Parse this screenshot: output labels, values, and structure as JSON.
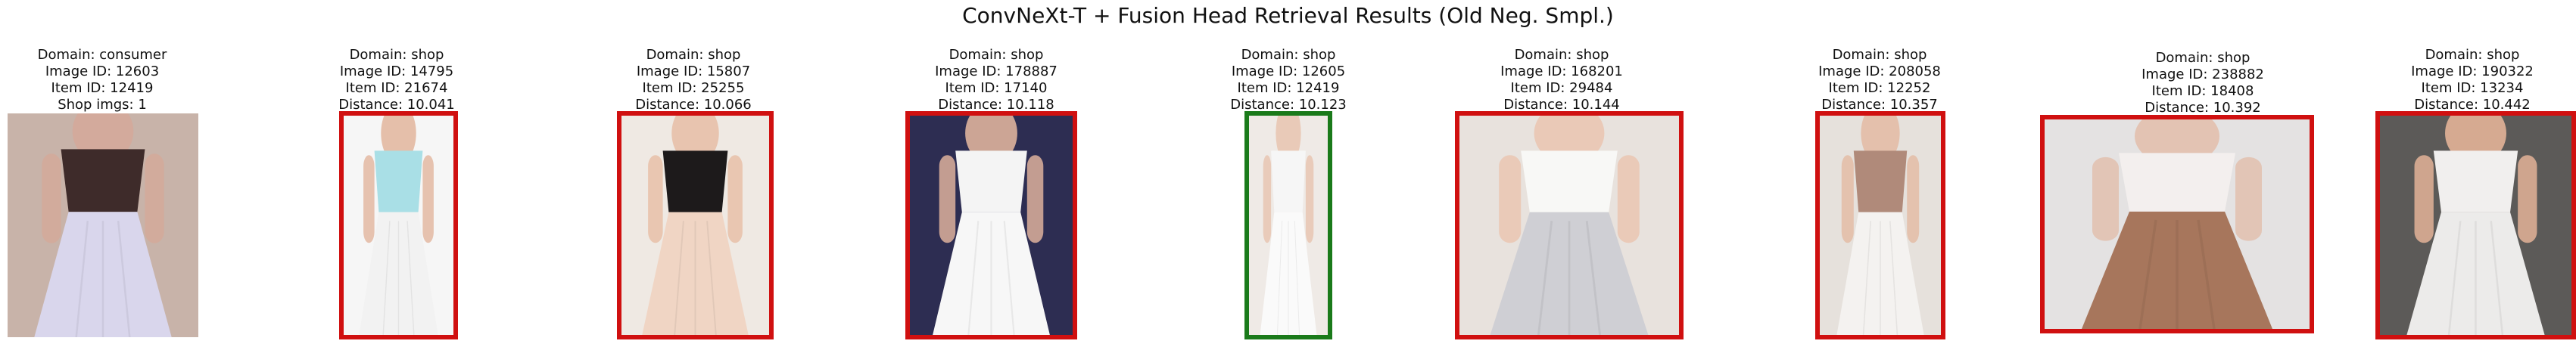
{
  "title": "ConvNeXt-T + Fusion Head Retrieval Results (Old Neg. Smpl.)",
  "results": [
    {
      "lines": [
        "Domain: consumer",
        "Image ID: 12603",
        "Item ID: 12419",
        "Shop imgs: 1"
      ],
      "match": "query",
      "border_color": "",
      "palette": {
        "bg": "#c8b3a9",
        "top": "#3e2b2a",
        "bottom": "#d9d6ec",
        "skin": "#d4a99a"
      }
    },
    {
      "lines": [
        "Domain: shop",
        "Image ID: 14795",
        "Item ID: 21674",
        "Distance: 10.041"
      ],
      "match": "incorrect",
      "border_color": "#d01010",
      "palette": {
        "bg": "#f6f6f6",
        "top": "#a9dfe6",
        "bottom": "#f2f2f2",
        "skin": "#e3b9a2"
      }
    },
    {
      "lines": [
        "Domain: shop",
        "Image ID: 15807",
        "Item ID: 25255",
        "Distance: 10.066"
      ],
      "match": "incorrect",
      "border_color": "#d01010",
      "palette": {
        "bg": "#efe9e3",
        "top": "#1d1a1b",
        "bottom": "#f0d5c4",
        "skin": "#e7c0a8"
      }
    },
    {
      "lines": [
        "Domain: shop",
        "Image ID: 178887",
        "Item ID: 17140",
        "Distance: 10.118"
      ],
      "match": "incorrect",
      "border_color": "#d01010",
      "palette": {
        "bg": "#2d2d52",
        "top": "#f4f4f4",
        "bottom": "#f7f7f7",
        "skin": "#deb29c"
      }
    },
    {
      "lines": [
        "Domain: shop",
        "Image ID: 12605",
        "Item ID: 12419",
        "Distance: 10.123"
      ],
      "match": "correct",
      "border_color": "#1a7a1a",
      "palette": {
        "bg": "#efeae6",
        "top": "#f6f6f6",
        "bottom": "#fafafa",
        "skin": "#e8c6b2"
      }
    },
    {
      "lines": [
        "Domain: shop",
        "Image ID: 168201",
        "Item ID: 29484",
        "Distance: 10.144"
      ],
      "match": "incorrect",
      "border_color": "#d01010",
      "palette": {
        "bg": "#e8e2dd",
        "top": "#f8f8f6",
        "bottom": "#cfcfd4",
        "skin": "#eac6b2"
      }
    },
    {
      "lines": [
        "Domain: shop",
        "Image ID: 208058",
        "Item ID: 12252",
        "Distance: 10.357"
      ],
      "match": "incorrect",
      "border_color": "#d01010",
      "palette": {
        "bg": "#e6e1dc",
        "top": "#b08a7a",
        "bottom": "#f4f2f0",
        "skin": "#e3bca6"
      }
    },
    {
      "lines": [
        "Domain: shop",
        "Image ID: 238882",
        "Item ID: 18408",
        "Distance: 10.392"
      ],
      "match": "incorrect",
      "border_color": "#d01010",
      "palette": {
        "bg": "#e4e2e2",
        "top": "#f3efee",
        "bottom": "#a7765c",
        "skin": "#e2c0ae"
      }
    },
    {
      "lines": [
        "Domain: shop",
        "Image ID: 190322",
        "Item ID: 13234",
        "Distance: 10.442"
      ],
      "match": "incorrect",
      "border_color": "#d01010",
      "palette": {
        "bg": "#5c5a58",
        "top": "#f1efee",
        "bottom": "#ecebea",
        "skin": "#e3b398"
      }
    }
  ]
}
